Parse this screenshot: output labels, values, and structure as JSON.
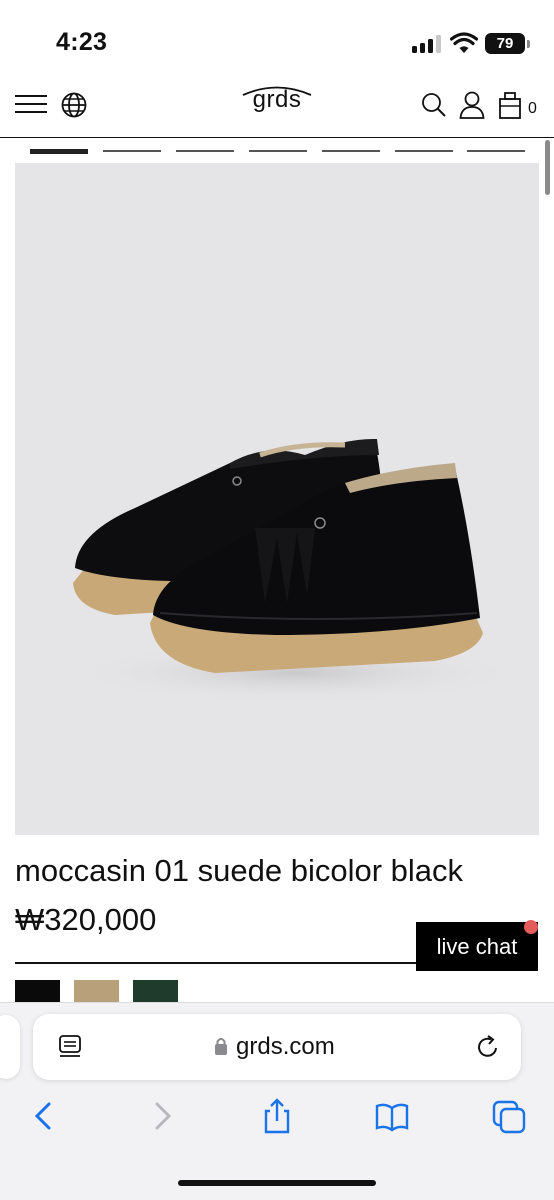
{
  "status_bar": {
    "time": "4:23",
    "battery": "79",
    "icons": [
      "signal-icon",
      "wifi-icon",
      "battery-icon"
    ]
  },
  "header": {
    "logo": "grds",
    "cart_count": "0",
    "icons": [
      "menu-icon",
      "globe-icon",
      "search-icon",
      "account-icon",
      "bag-icon"
    ]
  },
  "carousel": {
    "slide_count": 7,
    "active_index": 0
  },
  "product": {
    "name": "moccasin 01 suede bicolor black",
    "price": "₩320,000",
    "image": "black suede moccasin pair with fringe and crepe sole",
    "swatch_colors": [
      "#0a0a0a",
      "#b8a07a",
      "#1f3b2c"
    ]
  },
  "chat": {
    "label": "live chat",
    "notification_color": "#e35b5b"
  },
  "browser": {
    "url": "grds.com",
    "icons": [
      "reader-icon",
      "lock-icon",
      "reload-icon",
      "back-icon",
      "forward-icon",
      "share-icon",
      "bookmarks-icon",
      "tabs-icon"
    ],
    "accent": "#1a73e8"
  }
}
